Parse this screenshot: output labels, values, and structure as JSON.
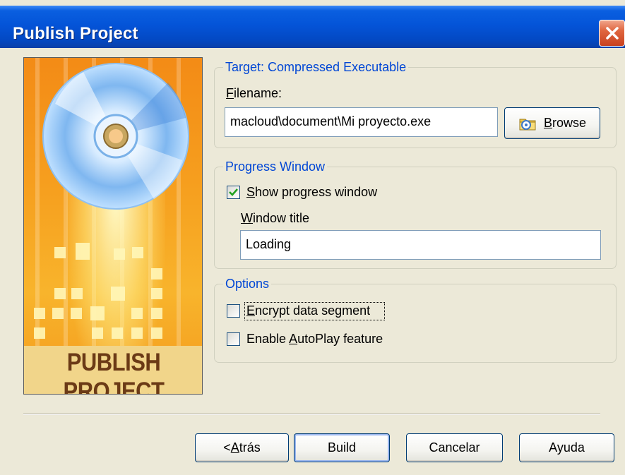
{
  "window": {
    "title": "Publish Project"
  },
  "banner": {
    "label": "PUBLISH PROJECT"
  },
  "target": {
    "group_title": "Target: Compressed Executable",
    "filename_label_first": "F",
    "filename_label_rest": "ilename:",
    "filename_value": "macloud\\document\\Mi proyecto.exe",
    "browse_first": "B",
    "browse_rest": "rowse"
  },
  "progress": {
    "group_title": "Progress Window",
    "show_first": "S",
    "show_rest": "how progress window",
    "show_checked": true,
    "title_label_first": "W",
    "title_label_rest": "indow title",
    "title_value": "Loading"
  },
  "options": {
    "group_title": "Options",
    "encrypt_first": "E",
    "encrypt_rest": "ncrypt data segment",
    "encrypt_checked": false,
    "autoplay_before": "Enable ",
    "autoplay_under": "A",
    "autoplay_rest": "utoPlay feature",
    "autoplay_checked": false
  },
  "buttons": {
    "back_pre": "< ",
    "back_under": "A",
    "back_rest": "trás",
    "build": "Build",
    "cancel": "Cancelar",
    "help": "Ayuda"
  },
  "colors": {
    "titlebar": "#0454d8",
    "group_title": "#0046d5",
    "close": "#e0663f"
  }
}
